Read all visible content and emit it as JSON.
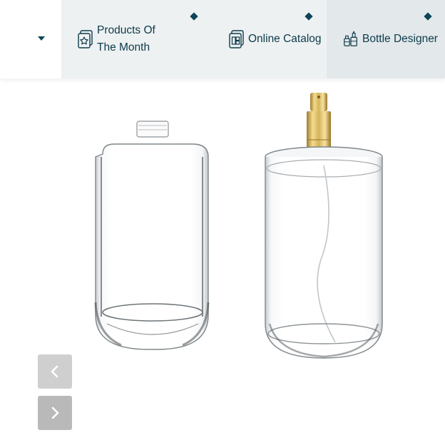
{
  "nav": {
    "items": [
      {
        "label": "Products Of The Month",
        "icon": "star-product-icon"
      },
      {
        "label": "Online Catalog",
        "icon": "catalog-icon"
      },
      {
        "label": "Bottle Designer",
        "icon": "bottle-designer-icon"
      }
    ],
    "active_index": 2
  },
  "gallery": {
    "images": [
      "rectangular-glass-perfume-bottle",
      "round-perfume-bottle-with-gold-spray-pump"
    ],
    "prev_icon": "chevron-left-icon",
    "next_icon": "chevron-right-icon"
  },
  "colors": {
    "nav_text": "#0c3a4a",
    "accent": "#0c4556",
    "nav_bg": "#eef1f2",
    "active_bg": "#e3e8ea",
    "gold": "#d4b45a"
  }
}
